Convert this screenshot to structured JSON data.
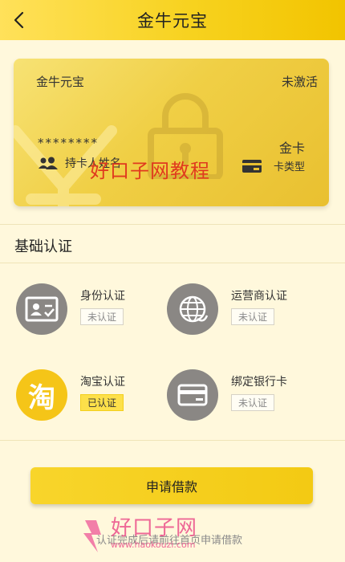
{
  "header": {
    "title": "金牛元宝",
    "back_icon": "chevron-left-icon"
  },
  "card": {
    "name": "金牛元宝",
    "status": "未激活",
    "number": "********",
    "holder_label": "持卡人姓名",
    "level": "金卡",
    "type_label": "卡类型"
  },
  "watermark": "好口子网教程",
  "section": {
    "title": "基础认证"
  },
  "auth_items": [
    {
      "label": "身份认证",
      "badge": "未认证",
      "icon": "id-card-icon"
    },
    {
      "label": "运营商认证",
      "badge": "未认证",
      "icon": "globe-icon"
    },
    {
      "label": "淘宝认证",
      "badge": "已认证",
      "icon": "taobao-icon",
      "icon_text": "淘"
    },
    {
      "label": "绑定银行卡",
      "badge": "未认证",
      "icon": "bank-card-icon"
    }
  ],
  "apply_button": "申请借款",
  "footer_hint": "认证完成后请前往首页申请借款",
  "logo": {
    "text": "好口子网",
    "url": "www.haokouzi.com"
  },
  "colors": {
    "brand_yellow": "#f5c518",
    "icon_gray": "#8a8784",
    "watermark_red": "#e03a1e",
    "logo_pink": "#ec4f8a"
  }
}
